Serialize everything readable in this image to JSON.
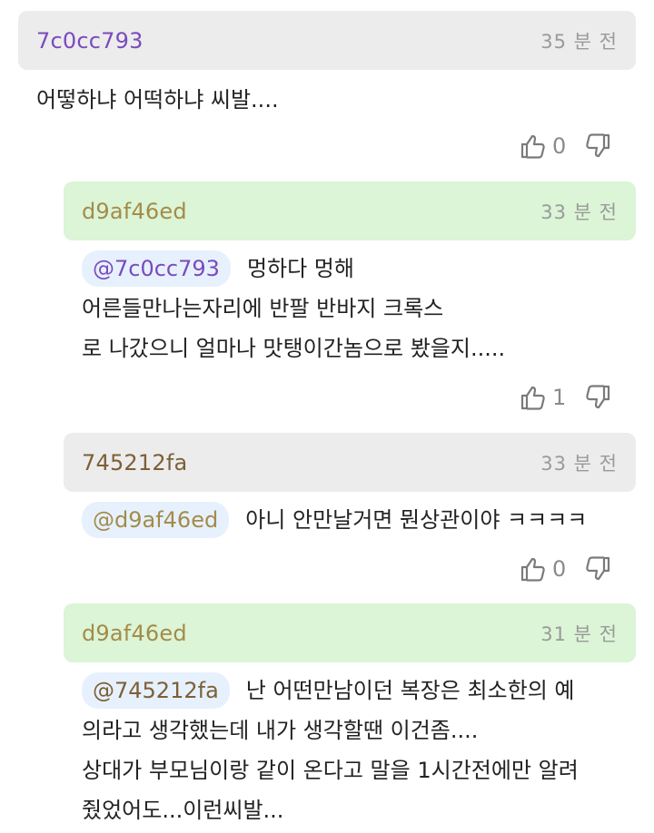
{
  "comments": [
    {
      "author": "7c0cc793",
      "time": "35 분 전",
      "lines": [
        "어떻하냐 어떡하냐 씨발...."
      ],
      "likes": "0"
    },
    {
      "author": "d9af46ed",
      "time": "33 분 전",
      "mention": "@7c0cc793",
      "lines": [
        "멍하다 멍해",
        "어른들만나는자리에 반팔 반바지 크록스",
        "로 나갔으니 얼마나 맛탱이간놈으로 봤을지....."
      ],
      "likes": "1"
    },
    {
      "author": "745212fa",
      "time": "33 분 전",
      "mention": "@d9af46ed",
      "lines": [
        "아니 안만날거면 뭔상관이야 ㅋㅋㅋㅋ"
      ],
      "likes": "0"
    },
    {
      "author": "d9af46ed",
      "time": "31 분 전",
      "mention": "@745212fa",
      "lines": [
        "난 어떤만남이던 복장은 최소한의 예",
        "의라고 생각했는데 내가 생각할땐 이건좀....",
        "상대가 부모님이랑 같이 온다고 말을 1시간전에만 알려",
        "줬었어도...이런씨발..."
      ]
    }
  ],
  "icons": {
    "like": "thumbs-up-icon",
    "dislike": "thumbs-down-icon"
  },
  "colors": {
    "gray_header": "#ececec",
    "green_header": "#dbf5d6",
    "mention_bg": "#e6f1fd"
  }
}
